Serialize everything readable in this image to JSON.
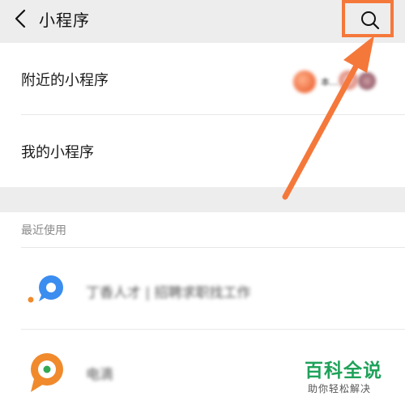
{
  "header": {
    "title": "小程序",
    "back_icon": "chevron-left-icon",
    "search_icon": "search-icon",
    "highlight_color": "#f5783b"
  },
  "main": {
    "items": [
      {
        "label": "附近的小程序"
      },
      {
        "label": "我的小程序"
      }
    ],
    "nearby_preview_text": "本..."
  },
  "recent": {
    "section_title": "最近使用",
    "apps": [
      {
        "name": "丁香人才 | 招聘求职找工作",
        "icon": "app-logo-icon"
      },
      {
        "name": "电滴",
        "icon": "app-logo-icon"
      }
    ]
  },
  "watermark": {
    "main": "百科全说",
    "sub": "助你轻松解决"
  },
  "colors": {
    "background": "#ededed",
    "card": "#ffffff",
    "accent": "#f5783b",
    "watermark_green": "#1fa25a"
  }
}
